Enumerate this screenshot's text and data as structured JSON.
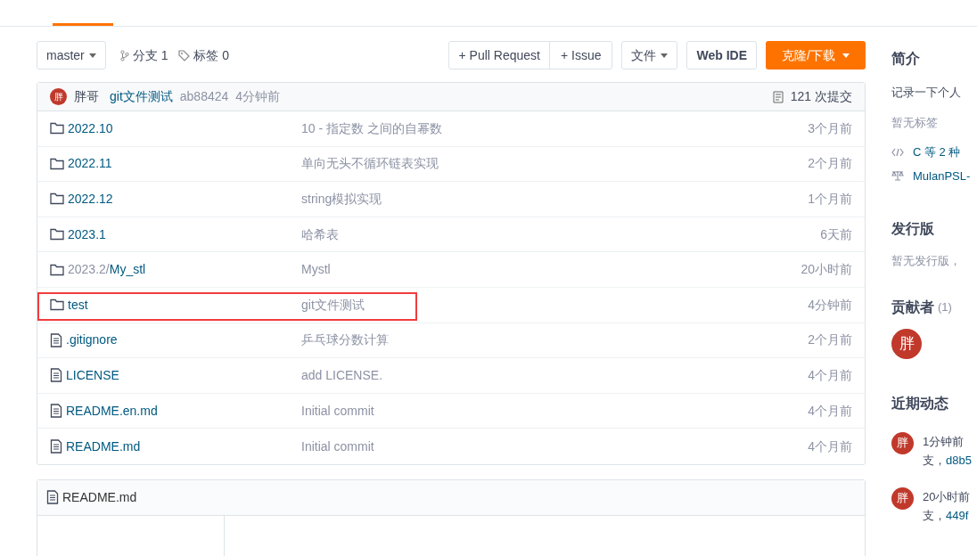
{
  "toolbar": {
    "branch": "master",
    "branches": "分支 1",
    "tags": "标签 0",
    "pull_request": "+ Pull Request",
    "issue": "+ Issue",
    "file_menu": "文件",
    "web_ide": "Web IDE",
    "clone": "克隆/下载"
  },
  "last_commit": {
    "avatar": "胖",
    "author": "胖哥",
    "message": "git文件测试",
    "hash": "ab88424",
    "time": "4分钟前",
    "commits": "121 次提交"
  },
  "files": [
    {
      "kind": "folder",
      "name": "2022.10",
      "message": "10 - 指定数 之间的自幂数",
      "time": "3个月前",
      "highlighted": false
    },
    {
      "kind": "folder",
      "name": "2022.11",
      "message": "单向无头不循环链表实现",
      "time": "2个月前",
      "highlighted": false
    },
    {
      "kind": "folder",
      "name": "2022.12",
      "message": "string模拟实现",
      "time": "1个月前",
      "highlighted": false
    },
    {
      "kind": "folder",
      "name": "2023.1",
      "message": "哈希表",
      "time": "6天前",
      "highlighted": false
    },
    {
      "kind": "folder",
      "name": "2023.2/",
      "sub": "My_stl",
      "message": "Mystl",
      "time": "20小时前",
      "highlighted": false
    },
    {
      "kind": "folder",
      "name": "test",
      "message": "git文件测试",
      "time": "4分钟前",
      "highlighted": true
    },
    {
      "kind": "file",
      "name": ".gitignore",
      "message": "乒乓球分数计算",
      "time": "2个月前",
      "highlighted": false
    },
    {
      "kind": "file",
      "name": "LICENSE",
      "message": "add LICENSE.",
      "time": "4个月前",
      "highlighted": false
    },
    {
      "kind": "file",
      "name": "README.en.md",
      "message": "Initial commit",
      "time": "4个月前",
      "highlighted": false
    },
    {
      "kind": "file",
      "name": "README.md",
      "message": "Initial commit",
      "time": "4个月前",
      "highlighted": false
    }
  ],
  "readme": {
    "title": "README.md"
  },
  "sidebar": {
    "intro_title": "简介",
    "intro": "记录一下个人",
    "no_tags": "暂无标签",
    "languages": "C 等 2 种",
    "license": "MulanPSL-",
    "release_title": "发行版",
    "no_release": "暂无发行版，",
    "contributors_title": "贡献者",
    "contributors_count": "(1)",
    "contributors": [
      {
        "avatar": "胖"
      }
    ],
    "activity_title": "近期动态",
    "activity": [
      {
        "avatar": "胖",
        "line1": "1分钟前",
        "line2": "支，",
        "link": "d8b5"
      },
      {
        "avatar": "胖",
        "line1": "20小时前",
        "line2": "支，",
        "link": "449f"
      }
    ]
  }
}
